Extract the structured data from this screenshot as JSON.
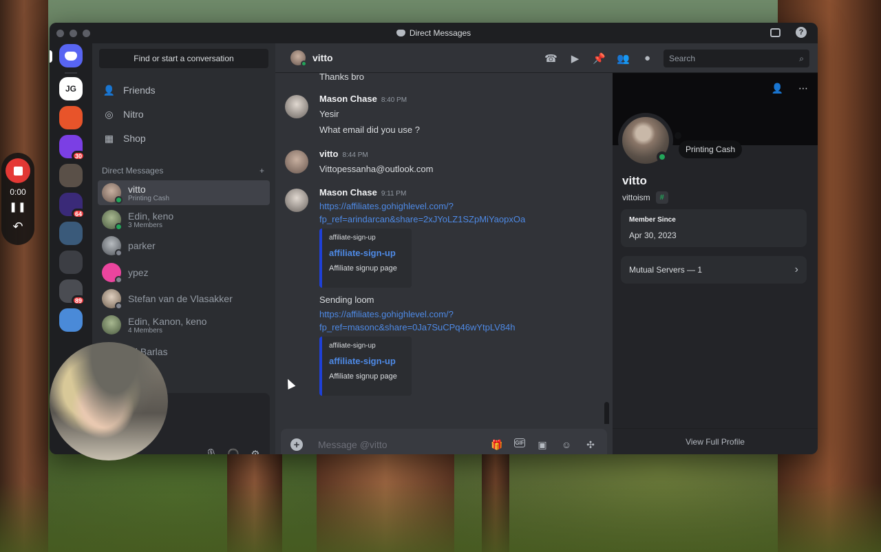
{
  "window": {
    "title": "Direct Messages"
  },
  "recorder": {
    "time": "0:00"
  },
  "servers": [
    {
      "name": "JG-server",
      "label": "JG",
      "color": "#ffffff",
      "badge": ""
    },
    {
      "name": "orange-server",
      "label": "",
      "color": "#e8542a",
      "badge": ""
    },
    {
      "name": "purple-server",
      "label": "",
      "color": "#7b3fe4",
      "badge": "30"
    },
    {
      "name": "photo-server",
      "label": "",
      "color": "#5a5048",
      "badge": ""
    },
    {
      "name": "vp-server",
      "label": "",
      "color": "#3a2a78",
      "badge": "64"
    },
    {
      "name": "person-server",
      "label": "",
      "color": "#3a5a7a",
      "badge": ""
    },
    {
      "name": "spreadsheet-server",
      "label": "",
      "color": "#3c3e44",
      "badge": ""
    },
    {
      "name": "diamond-server",
      "label": "",
      "color": "#4a4c52",
      "badge": "89"
    },
    {
      "name": "sky-server",
      "label": "",
      "color": "#4a8ad8",
      "badge": ""
    }
  ],
  "sidebar": {
    "search": "Find or start a conversation",
    "nav": [
      {
        "label": "Friends"
      },
      {
        "label": "Nitro"
      },
      {
        "label": "Shop"
      }
    ],
    "dm_header": "Direct Messages",
    "dms": [
      {
        "name": "vitto",
        "sub": "Printing Cash",
        "active": true
      },
      {
        "name": "Edin, keno",
        "sub": "3 Members"
      },
      {
        "name": "parker",
        "sub": ""
      },
      {
        "name": "ypez",
        "sub": ""
      },
      {
        "name": "Stefan van de Vlasakker",
        "sub": ""
      },
      {
        "name": "Edin, Kanon, keno",
        "sub": "4 Members"
      },
      {
        "name": "ail Barlas",
        "sub": ""
      }
    ]
  },
  "chat": {
    "recipient": "vitto",
    "search_placeholder": "Search",
    "composer_placeholder": "Message @vitto",
    "first_line": "Thanks bro",
    "messages": [
      {
        "author": "Mason Chase",
        "time": "8:40 PM",
        "lines": [
          "Yesir",
          "What email did you use ?"
        ]
      },
      {
        "author": "vitto",
        "time": "8:44 PM",
        "lines": [
          "Vittopessanha@outlook.com"
        ]
      },
      {
        "author": "Mason Chase",
        "time": "9:11 PM",
        "link1": [
          "https://affiliates.gohighlevel.com/?",
          "fp_ref=arindarcan&share=2xJYoLZ1SZpMiYaopxOa"
        ],
        "embed1": {
          "site": "affiliate-sign-up",
          "title": "affiliate-sign-up",
          "desc": "Affiliate signup page"
        },
        "text2": "Sending loom",
        "link2": [
          "https://affiliates.gohighlevel.com/?",
          "fp_ref=masonc&share=0Ja7SuCPq46wYtpLV84h"
        ],
        "embed2": {
          "site": "affiliate-sign-up",
          "title": "affiliate-sign-up",
          "desc": "Affiliate signup page"
        }
      }
    ]
  },
  "profile": {
    "status": "Printing Cash",
    "display_name": "vitto",
    "username": "vittoism",
    "member_since_label": "Member Since",
    "member_since": "Apr 30, 2023",
    "mutual_servers": "Mutual Servers — 1",
    "footer": "View Full Profile"
  }
}
